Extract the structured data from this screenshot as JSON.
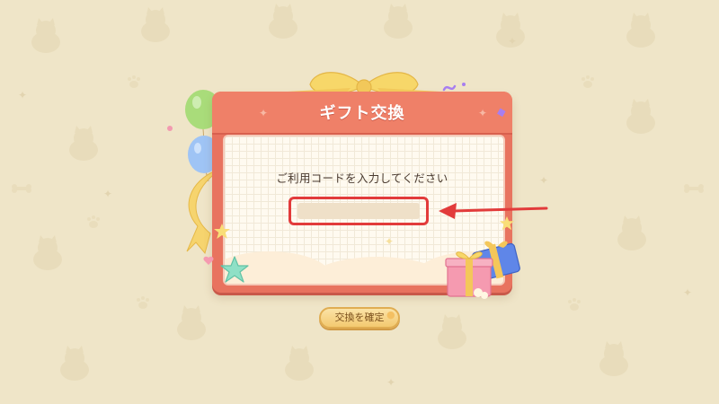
{
  "dialog": {
    "title": "ギフト交換",
    "prompt": "ご利用コードを入力してください"
  },
  "code_input": {
    "value": "",
    "placeholder": ""
  },
  "confirm_button": {
    "label": "交換を確定"
  },
  "colors": {
    "background": "#efe5c8",
    "frame": "#e8735f",
    "header": "#ef8068",
    "panel": "#fffaf0",
    "input_fill": "#efe0c8",
    "highlight": "#e23b3b",
    "button": "#f3c970"
  },
  "icons": [
    "shiba-dog-pattern-icon",
    "paw-icon",
    "bone-icon",
    "sparkle-icon",
    "ribbon-bow-icon",
    "balloon-icon",
    "star-icon",
    "gift-box-icon",
    "arrow-left-icon"
  ]
}
